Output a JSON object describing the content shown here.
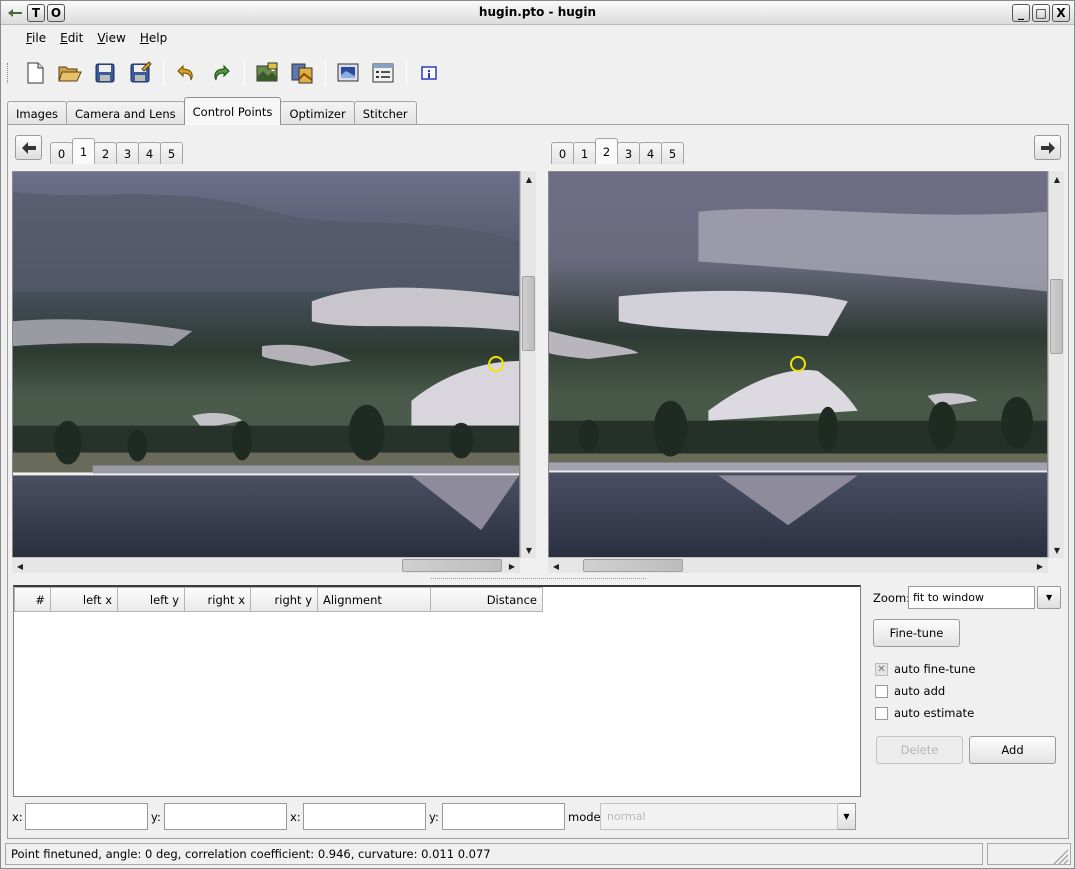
{
  "window": {
    "title": "hugin.pto - hugin",
    "left_buttons": [
      "T",
      "O"
    ],
    "right_buttons": [
      "_",
      "□",
      "X"
    ]
  },
  "menu": [
    {
      "label": "File",
      "key": "F",
      "rest": "ile"
    },
    {
      "label": "Edit",
      "key": "E",
      "rest": "dit"
    },
    {
      "label": "View",
      "key": "V",
      "rest": "iew"
    },
    {
      "label": "Help",
      "key": "H",
      "rest": "elp"
    }
  ],
  "toolbar": [
    "new-icon",
    "open-icon",
    "save-icon",
    "save-as-icon",
    "undo-icon",
    "redo-icon",
    "add-image-icon",
    "add-series-icon",
    "preview-icon",
    "optimize-icon",
    "about-icon"
  ],
  "tabs": [
    "Images",
    "Camera and Lens",
    "Control Points",
    "Optimizer",
    "Stitcher"
  ],
  "active_tab": "Control Points",
  "left_image": {
    "tabs": [
      "0",
      "1",
      "2",
      "3",
      "4",
      "5"
    ],
    "active": "1"
  },
  "right_image": {
    "tabs": [
      "0",
      "1",
      "2",
      "3",
      "4",
      "5"
    ],
    "active": "2"
  },
  "table": {
    "columns": [
      "#",
      "left x",
      "left y",
      "right x",
      "right y",
      "Alignment",
      "Distance"
    ],
    "rows": []
  },
  "zoom": {
    "label": "Zoom:",
    "value": "fit to window"
  },
  "fine_tune_label": "Fine-tune",
  "checks": [
    {
      "label": "auto fine-tune",
      "checked": true,
      "disabled": true
    },
    {
      "label": "auto add",
      "checked": false,
      "disabled": false
    },
    {
      "label": "auto estimate",
      "checked": false,
      "disabled": false
    }
  ],
  "delete_label": "Delete",
  "add_label": "Add",
  "coords": {
    "x1_label": "x:",
    "y1_label": "y:",
    "x2_label": "x:",
    "y2_label": "y:",
    "mode_label": "mode:",
    "mode_value": "normal"
  },
  "status": "Point finetuned, angle: 0 deg, correlation coefficient: 0.946, curvature: 0.011 0.077",
  "colors": {
    "marker": "#f5e600",
    "window_bg": "#f0f0f0"
  }
}
